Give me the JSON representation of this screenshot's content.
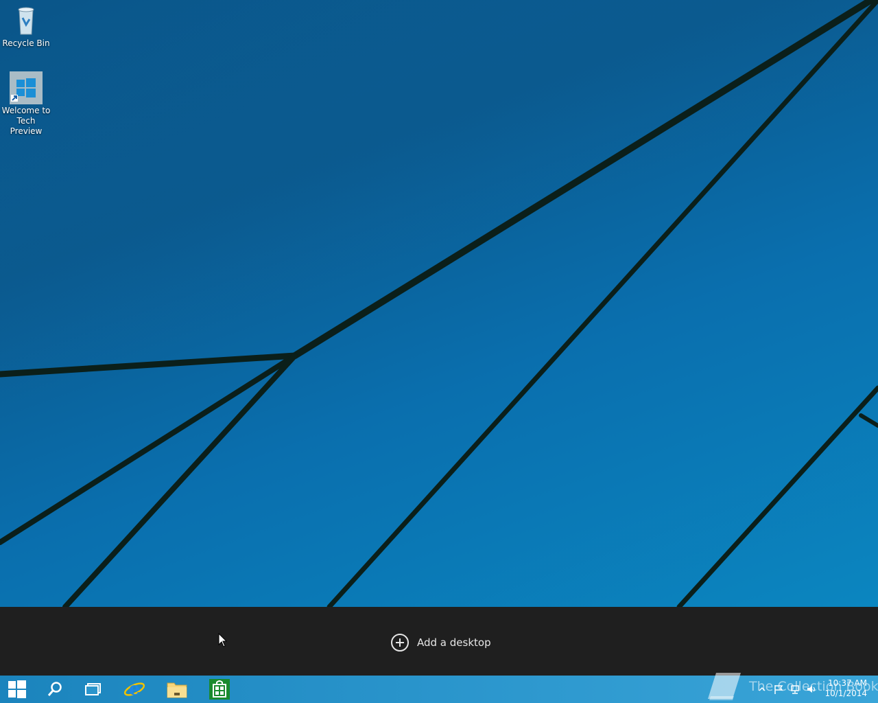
{
  "desktop": {
    "icons": [
      {
        "label": "Recycle Bin",
        "icon": "recycle-bin-icon"
      },
      {
        "label": "Welcome to Tech Preview",
        "icon": "windows-logo-icon"
      }
    ]
  },
  "task_view": {
    "add_desktop_label": "Add a desktop",
    "add_icon": "plus-circle-icon"
  },
  "taskbar": {
    "buttons": [
      {
        "name": "start",
        "icon": "windows-logo-icon"
      },
      {
        "name": "search",
        "icon": "search-icon"
      },
      {
        "name": "task-view",
        "icon": "task-view-icon"
      },
      {
        "name": "internet-explorer",
        "icon": "internet-explorer-icon"
      },
      {
        "name": "file-explorer",
        "icon": "folder-icon"
      },
      {
        "name": "store",
        "icon": "store-icon"
      }
    ],
    "tray": {
      "icons": [
        "chevron-up-icon",
        "flag-icon",
        "network-icon",
        "speaker-icon"
      ],
      "time": "10:37 AM",
      "date": "10/1/2014"
    }
  },
  "watermark": {
    "text": "The Collection Book"
  },
  "colors": {
    "taskbar": "#2a95cc",
    "task_view_bar": "#1f1f1f",
    "store_green": "#1a8a2e"
  }
}
